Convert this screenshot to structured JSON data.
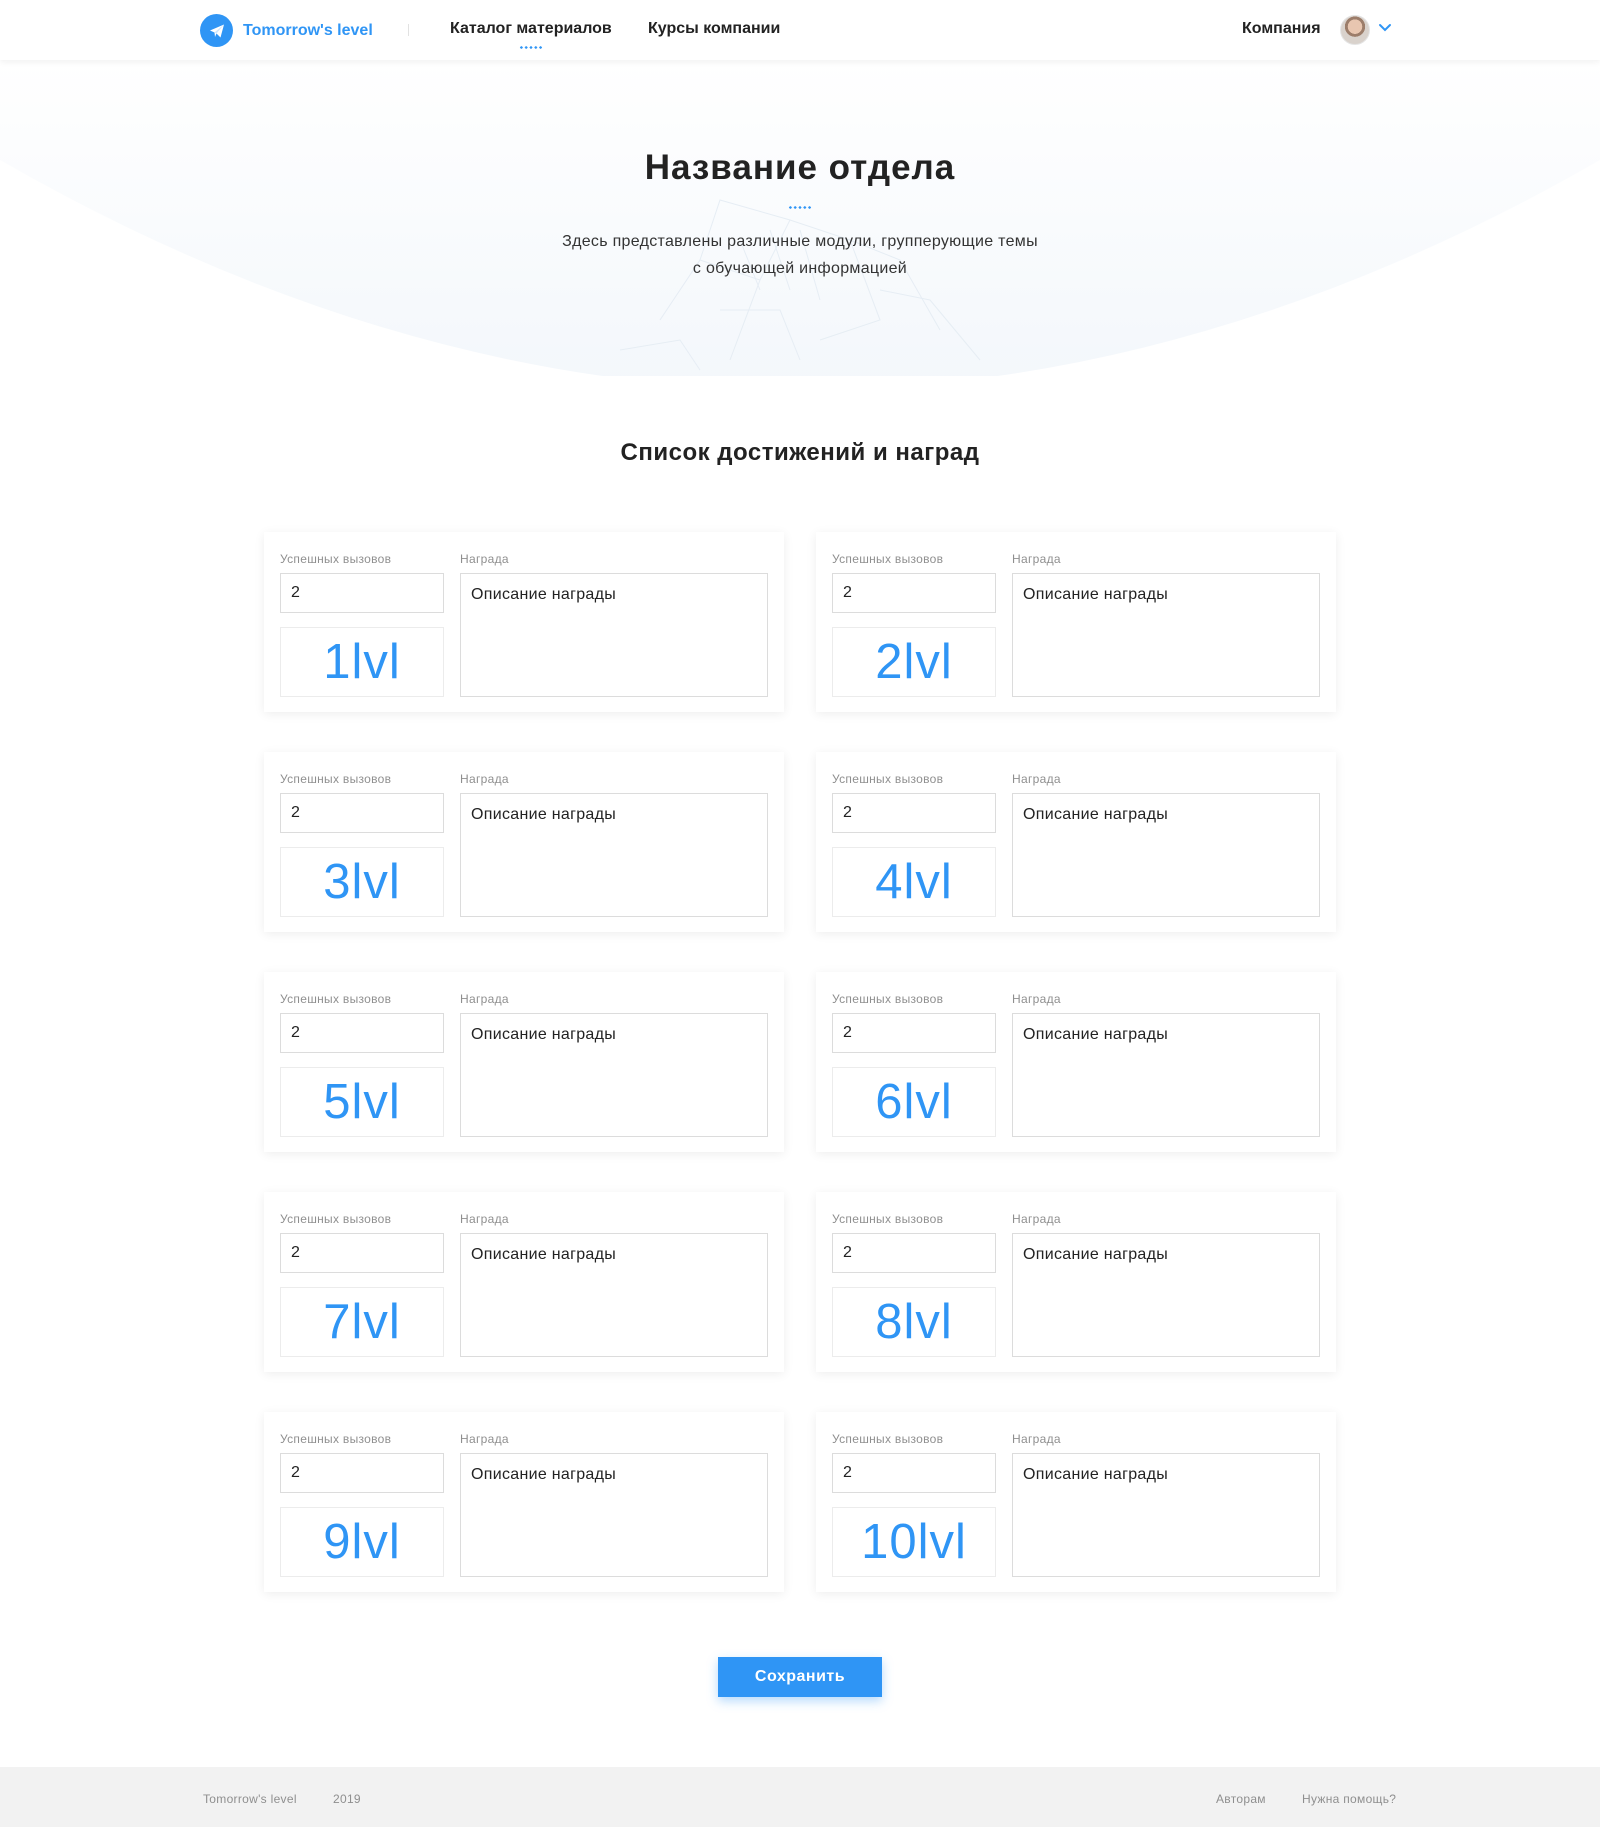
{
  "header": {
    "brand": "Tomorrow's level",
    "nav": [
      {
        "label": "Каталог материалов",
        "active": true
      },
      {
        "label": "Курсы компании",
        "active": false
      }
    ],
    "company_label": "Компания"
  },
  "hero": {
    "title": "Название отдела",
    "subtitle_line1": "Здесь представлены различные модули, групперующие темы",
    "subtitle_line2": "с обучающей информацией"
  },
  "section_title": "Список достижений и наград",
  "labels": {
    "count": "Успешных вызовов",
    "reward": "Награда"
  },
  "levels": [
    {
      "level": "1lvl",
      "count": "2",
      "reward": "Описание награды"
    },
    {
      "level": "2lvl",
      "count": "2",
      "reward": "Описание награды"
    },
    {
      "level": "3lvl",
      "count": "2",
      "reward": "Описание награды"
    },
    {
      "level": "4lvl",
      "count": "2",
      "reward": "Описание награды"
    },
    {
      "level": "5lvl",
      "count": "2",
      "reward": "Описание награды"
    },
    {
      "level": "6lvl",
      "count": "2",
      "reward": "Описание награды"
    },
    {
      "level": "7lvl",
      "count": "2",
      "reward": "Описание награды"
    },
    {
      "level": "8lvl",
      "count": "2",
      "reward": "Описание награды"
    },
    {
      "level": "9lvl",
      "count": "2",
      "reward": "Описание награды"
    },
    {
      "level": "10lvl",
      "count": "2",
      "reward": "Описание награды"
    }
  ],
  "save_label": "Сохранить",
  "footer": {
    "brand": "Tomorrow's level",
    "year": "2019",
    "authors_link": "Авторам",
    "help_link": "Нужна помощь?"
  },
  "colors": {
    "accent": "#2f95f5",
    "text": "#222222",
    "muted": "#8f8f8f",
    "footer_bg": "#f2f2f2"
  },
  "icons": {
    "logo": "paper-plane-icon",
    "user_menu": "chevron-down-icon"
  }
}
